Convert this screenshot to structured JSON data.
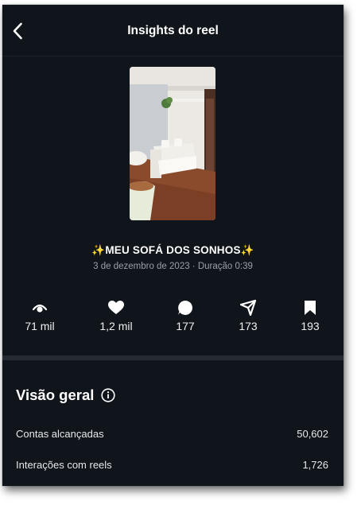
{
  "header": {
    "title": "Insights do reel",
    "back_icon": "chevron-left-icon"
  },
  "reel": {
    "title": "✨MEU SOFÁ DOS SONHOS✨",
    "subtitle": "3 de dezembro de 2023 · Duração 0:39"
  },
  "stats": [
    {
      "icon": "eye-icon",
      "value": "71 mil"
    },
    {
      "icon": "heart-icon",
      "value": "1,2 mil"
    },
    {
      "icon": "comment-icon",
      "value": "177"
    },
    {
      "icon": "share-icon",
      "value": "173"
    },
    {
      "icon": "bookmark-icon",
      "value": "193"
    }
  ],
  "overview": {
    "title": "Visão geral",
    "info_icon": "info-icon",
    "rows": [
      {
        "label": "Contas alcançadas",
        "value": "50,602"
      },
      {
        "label": "Interações com reels",
        "value": "1,726"
      }
    ]
  },
  "colors": {
    "background": "#10141b",
    "divider": "#262b33",
    "text_primary": "#ffffff",
    "text_secondary": "#9aa0a8"
  }
}
